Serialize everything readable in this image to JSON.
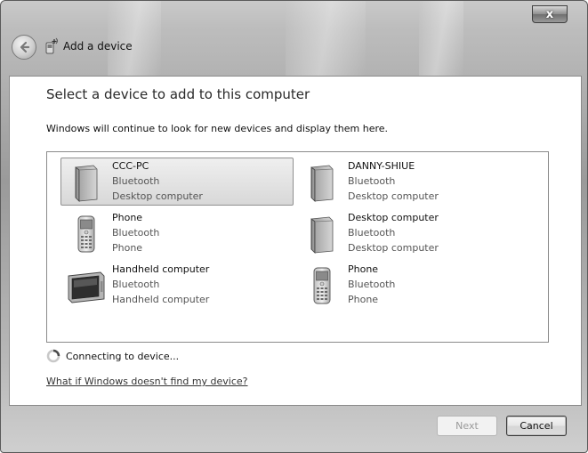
{
  "window": {
    "title": "Add a device",
    "close_label": "x"
  },
  "main": {
    "heading": "Select a device to add to this computer",
    "subtext": "Windows will continue to look for new devices and display them here."
  },
  "devices": [
    {
      "name": "CCC-PC",
      "type": "Bluetooth",
      "category": "Desktop computer",
      "icon": "desktop-computer-icon",
      "selected": true
    },
    {
      "name": "DANNY-SHIUE",
      "type": "Bluetooth",
      "category": "Desktop computer",
      "icon": "desktop-computer-icon",
      "selected": false
    },
    {
      "name": "Phone",
      "type": "Bluetooth",
      "category": "Phone",
      "icon": "phone-icon",
      "selected": false
    },
    {
      "name": "Desktop computer",
      "type": "Bluetooth",
      "category": "Desktop computer",
      "icon": "desktop-computer-icon",
      "selected": false
    },
    {
      "name": "Handheld computer",
      "type": "Bluetooth",
      "category": "Handheld computer",
      "icon": "handheld-computer-icon",
      "selected": false
    },
    {
      "name": "Phone",
      "type": "Bluetooth",
      "category": "Phone",
      "icon": "phone-icon",
      "selected": false
    }
  ],
  "status": {
    "text": "Connecting to device...",
    "icon": "spinner-icon"
  },
  "help_link": "What if Windows doesn't find my device?",
  "footer": {
    "next_label": "Next",
    "next_enabled": false,
    "cancel_label": "Cancel"
  }
}
